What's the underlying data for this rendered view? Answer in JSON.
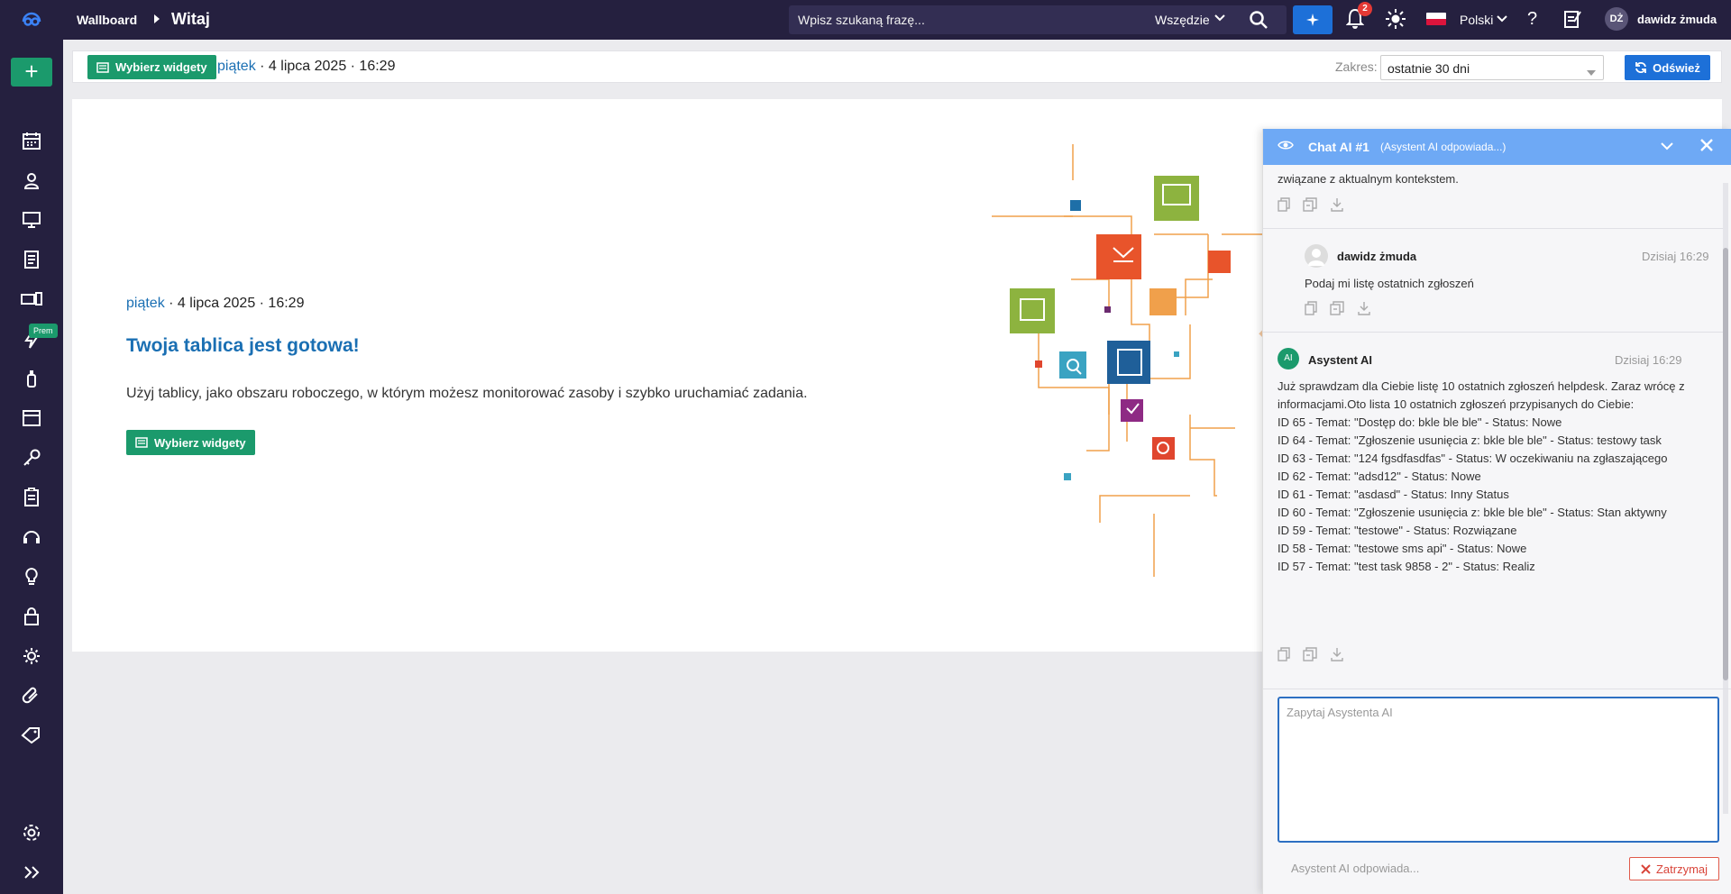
{
  "topbar": {
    "breadcrumb_root": "Wallboard",
    "breadcrumb_current": "Witaj",
    "search_placeholder": "Wpisz szukaną frazę...",
    "search_scope": "Wszędzie",
    "notifications_count": "2",
    "language": "Polski",
    "user_initials": "DŻ",
    "user_name": "dawidz żmuda"
  },
  "sidebar": {
    "add_label": "+",
    "prem_badge": "Prem",
    "icons": [
      "calendar-icon",
      "user-icon",
      "monitor-icon",
      "document-icon",
      "devices-icon",
      "bolt-icon",
      "usb-icon",
      "window-icon",
      "key-icon",
      "clipboard-icon",
      "support-icon",
      "lightbulb-icon",
      "lock-icon",
      "settings-cycle-icon",
      "attachment-icon",
      "tag-icon",
      "gear-icon",
      "expand-icon"
    ]
  },
  "toolbar": {
    "choose_widgets": "Wybierz widgety",
    "day": "piątek",
    "date": " · 4 lipca 2025 · 16:29",
    "range_label": "Zakres:",
    "range_value": "ostatnie 30 dni",
    "refresh": "Odśwież"
  },
  "welcome": {
    "day": "piątek",
    "date": " · 4 lipca 2025 · 16:29",
    "title": "Twoja tablica jest gotowa!",
    "description": "Użyj tablicy, jako obszaru roboczego, w którym możesz monitorować zasoby i szybko uruchamiać zadania.",
    "button": "Wybierz widgety"
  },
  "chat": {
    "title": "Chat AI #1",
    "subtitle": "(Asystent AI odpowiada...)",
    "truncated_text": "związane z aktualnym kontekstem.",
    "user_message": {
      "author": "dawidz żmuda",
      "time": "Dzisiaj 16:29",
      "text": "Podaj mi listę ostatnich zgłoszeń"
    },
    "ai_message": {
      "avatar": "AI",
      "author": "Asystent AI",
      "time": "Dzisiaj 16:29",
      "lines": [
        "Już sprawdzam dla Ciebie listę 10 ostatnich zgłoszeń helpdesk. Zaraz wrócę z informacjami.Oto lista 10 ostatnich zgłoszeń przypisanych do Ciebie:",
        "ID 65 - Temat: \"Dostęp do: bkle ble ble\" - Status: Nowe",
        "ID 64 - Temat: \"Zgłoszenie usunięcia z: bkle ble ble\" - Status: testowy task",
        "ID 63 - Temat: \"124 fgsdfasdfas\" - Status: W oczekiwaniu na zgłaszającego",
        "ID 62 - Temat: \"adsd12\" - Status: Nowe",
        "ID 61 - Temat: \"asdasd\" - Status: Inny Status",
        "ID 60 - Temat: \"Zgłoszenie usunięcia z: bkle ble ble\" - Status: Stan aktywny",
        "ID 59 - Temat: \"testowe\" - Status: Rozwiązane",
        "ID 58 - Temat: \"testowe sms api\" - Status: Nowe",
        "ID 57 - Temat: \"test task 9858 - 2\" - Status: Realiz"
      ]
    },
    "input_placeholder": "Zapytaj Asystenta AI",
    "status": "Asystent AI odpowiada...",
    "stop": "Zatrzymaj"
  },
  "colors": {
    "nav_bg": "#25203f",
    "green": "#1b9a6c",
    "blue": "#1d70d8",
    "chat_header": "#6ea9f5",
    "link": "#1a6fb3"
  }
}
